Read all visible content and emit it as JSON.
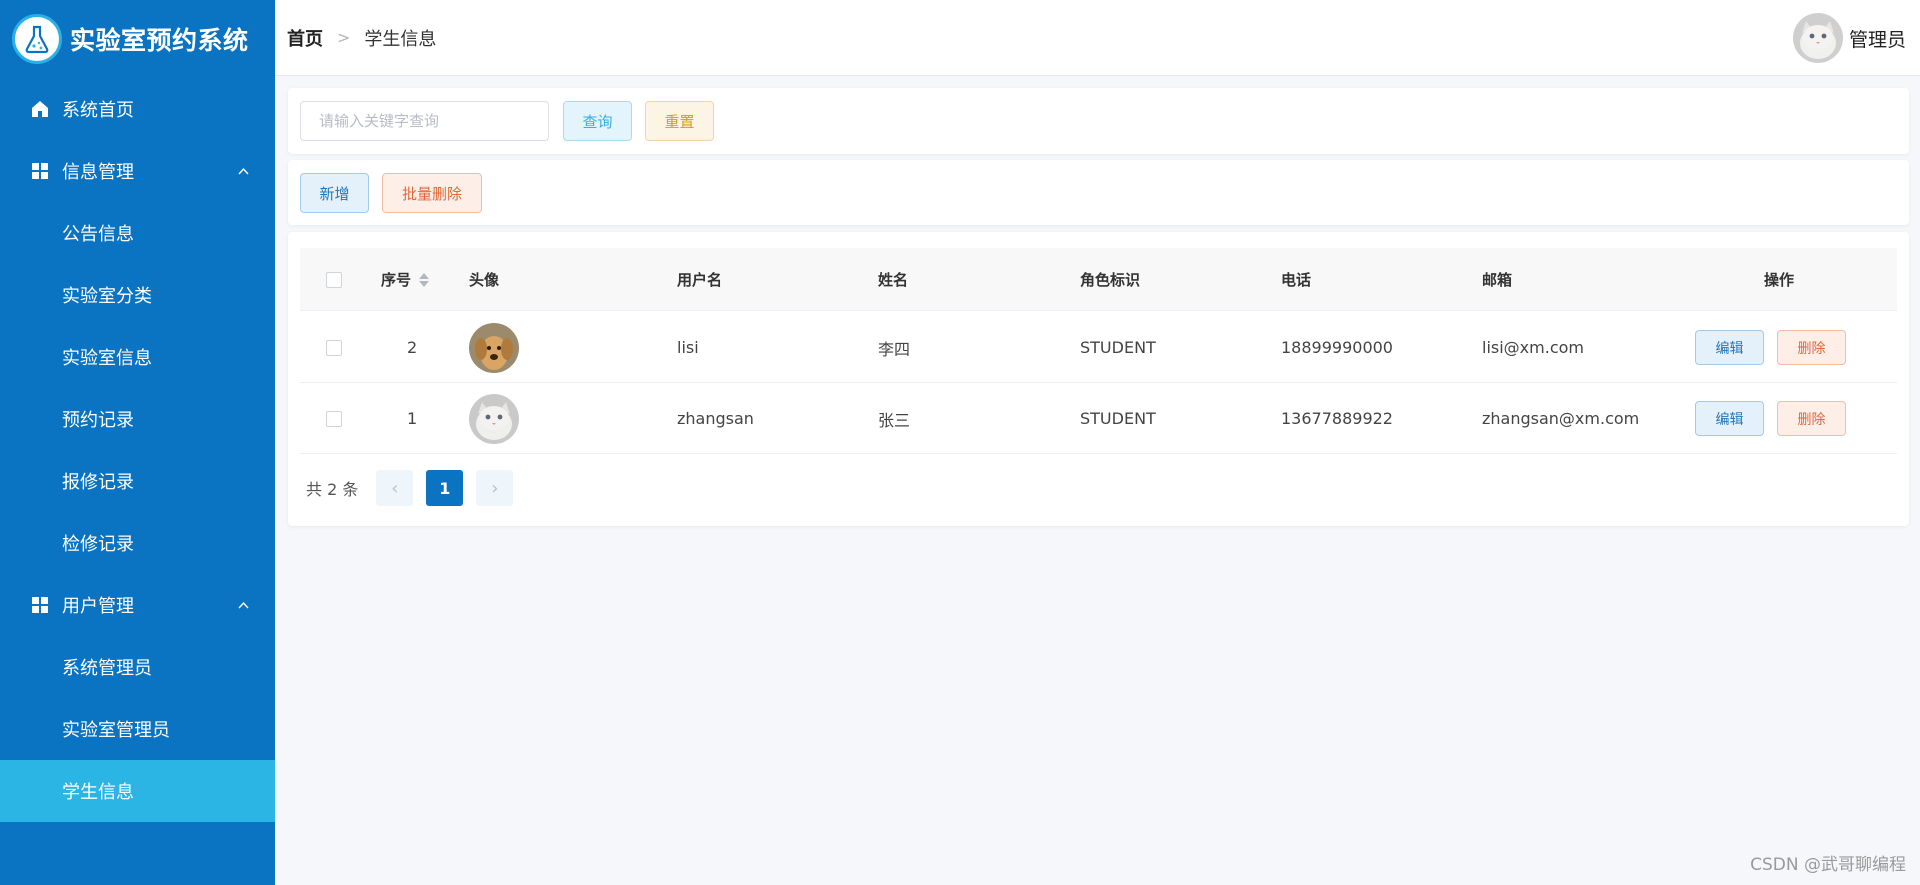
{
  "app": {
    "title": "实验室预约系统"
  },
  "sidebar": {
    "items": [
      {
        "label": "系统首页",
        "icon": "home-icon"
      },
      {
        "label": "信息管理",
        "icon": "grid-icon",
        "expanded": true
      },
      {
        "label": "公告信息"
      },
      {
        "label": "实验室分类"
      },
      {
        "label": "实验室信息"
      },
      {
        "label": "预约记录"
      },
      {
        "label": "报修记录"
      },
      {
        "label": "检修记录"
      },
      {
        "label": "用户管理",
        "icon": "grid-icon",
        "expanded": true
      },
      {
        "label": "系统管理员"
      },
      {
        "label": "实验室管理员"
      },
      {
        "label": "学生信息",
        "active": true
      }
    ]
  },
  "header": {
    "breadcrumb_home": "首页",
    "breadcrumb_separator": ">",
    "breadcrumb_current": "学生信息",
    "user_name": "管理员"
  },
  "search": {
    "placeholder": "请输入关键字查询",
    "value": "",
    "query_label": "查询",
    "reset_label": "重置"
  },
  "toolbar": {
    "add_label": "新增",
    "batch_delete_label": "批量删除"
  },
  "table": {
    "headers": {
      "index": "序号",
      "avatar": "头像",
      "username": "用户名",
      "name": "姓名",
      "role": "角色标识",
      "phone": "电话",
      "email": "邮箱",
      "actions": "操作"
    },
    "rows": [
      {
        "index": "2",
        "avatar": "dog-avatar",
        "username": "lisi",
        "name": "李四",
        "role": "STUDENT",
        "phone": "18899990000",
        "email": "lisi@xm.com",
        "edit": "编辑",
        "delete": "删除"
      },
      {
        "index": "1",
        "avatar": "cat-avatar",
        "username": "zhangsan",
        "name": "张三",
        "role": "STUDENT",
        "phone": "13677889922",
        "email": "zhangsan@xm.com",
        "edit": "编辑",
        "delete": "删除"
      }
    ]
  },
  "pagination": {
    "total_text": "共 2 条",
    "current_page": "1",
    "prev": "‹",
    "next": "›"
  },
  "watermark": "CSDN @武哥聊编程",
  "colors": {
    "sidebar_bg": "#0a73c2",
    "sidebar_active": "#2bb5e5",
    "page_bg": "#f5f7fb",
    "primary": "#0a73c2"
  }
}
